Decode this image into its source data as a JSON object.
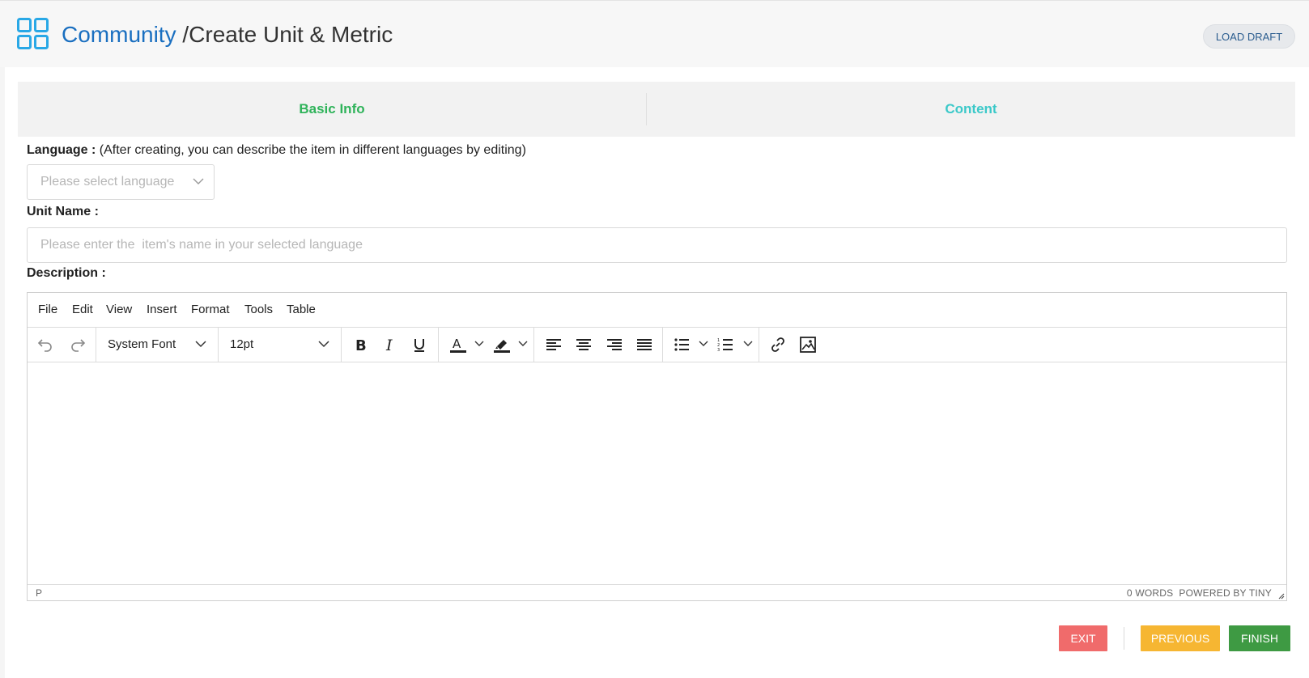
{
  "header": {
    "brand": "Community",
    "separator": " /",
    "page_title": "Create Unit & Metric",
    "load_draft_label": "LOAD DRAFT"
  },
  "tabs": [
    {
      "label": "Basic Info",
      "state": "active"
    },
    {
      "label": "Content",
      "state": "inactive"
    }
  ],
  "form": {
    "language": {
      "label": "Language :",
      "hint": " (After creating, you can describe the item in different languages by editing)",
      "placeholder": "Please select language"
    },
    "unit_name": {
      "label": "Unit Name :",
      "placeholder": "Please enter the  item's name in your selected language"
    },
    "description": {
      "label": "Description :"
    }
  },
  "editor": {
    "menu": [
      "File",
      "Edit",
      "View",
      "Insert",
      "Format",
      "Tools",
      "Table"
    ],
    "font_family": "System Font",
    "font_size": "12pt",
    "toolbar_icons": [
      "undo-icon",
      "redo-icon",
      "bold-icon",
      "italic-icon",
      "underline-icon",
      "text-color-icon",
      "highlight-icon",
      "align-left-icon",
      "align-center-icon",
      "align-right-icon",
      "align-justify-icon",
      "bullet-list-icon",
      "numbered-list-icon",
      "link-icon",
      "image-icon"
    ],
    "status_path": "P",
    "word_count": "0 WORDS",
    "powered_by": "POWERED BY TINY"
  },
  "actions": {
    "exit": "EXIT",
    "previous": "PREVIOUS",
    "finish": "FINISH"
  },
  "colors": {
    "brand_blue": "#1a6fc0",
    "logo_cyan": "#29a8e6",
    "tab_active_green": "#2fb35a",
    "tab_content_teal": "#3cc9c9",
    "exit_red": "#f06b6b",
    "previous_yellow": "#f6b632",
    "finish_green": "#3e9a43"
  }
}
